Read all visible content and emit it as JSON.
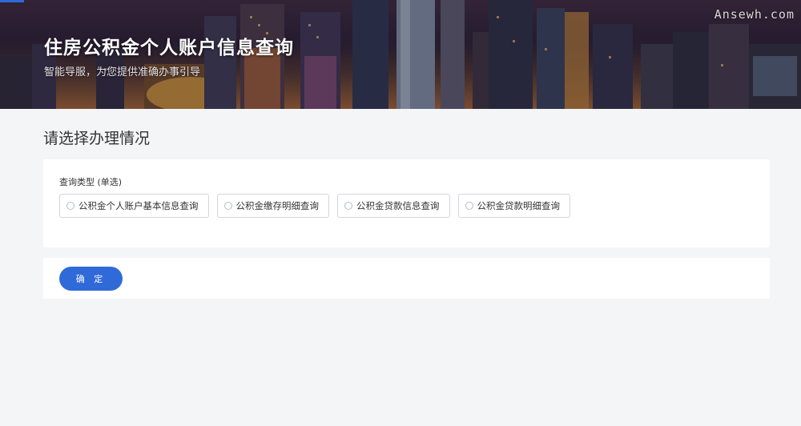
{
  "banner": {
    "title": "住房公积金个人账户信息查询",
    "subtitle": "智能导服，为您提供准确办事引导",
    "watermark": "Ansewh.com"
  },
  "page": {
    "section_title": "请选择办理情况"
  },
  "query_type": {
    "label": "查询类型 (单选)",
    "options": [
      {
        "label": "公积金个人账户基本信息查询",
        "selected": false
      },
      {
        "label": "公积金缴存明细查询",
        "selected": false
      },
      {
        "label": "公积金贷款信息查询",
        "selected": false
      },
      {
        "label": "公积金贷款明细查询",
        "selected": false
      }
    ]
  },
  "actions": {
    "confirm_label": "确 定"
  },
  "colors": {
    "accent": "#2f6ad8",
    "page_bg": "#f4f5f7",
    "card_bg": "#ffffff",
    "option_border": "#d3d6dc"
  }
}
